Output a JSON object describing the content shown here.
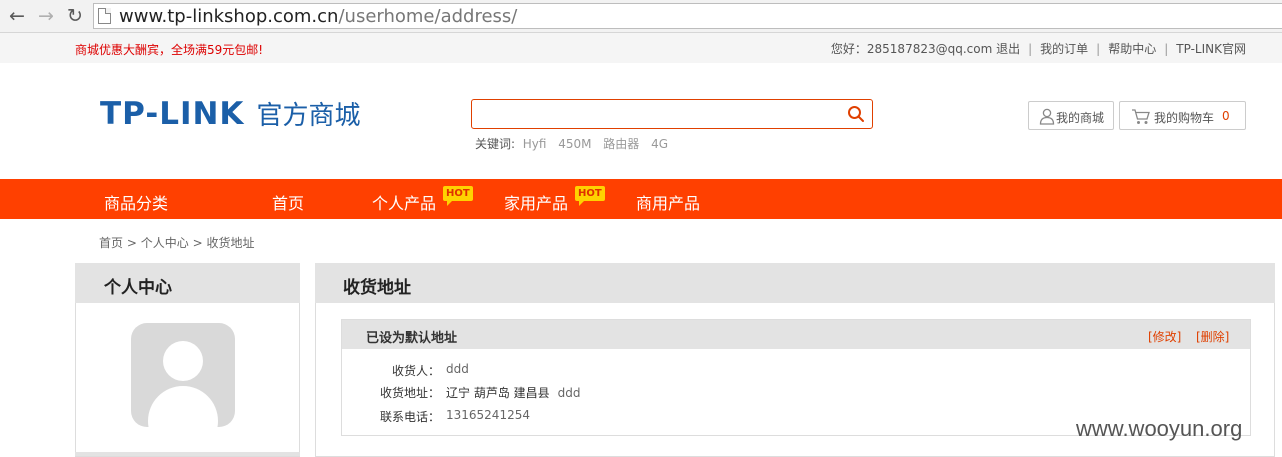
{
  "browser": {
    "url_host": "www.tp-linkshop.com.cn",
    "url_path": "/userhome/address/"
  },
  "top_bar": {
    "promo": "商城优惠大酬宾，全场满59元包邮!",
    "greeting": "您好：285187823@qq.com 退出",
    "my_orders": "我的订单",
    "help_center": "帮助中心",
    "official_site": "TP-LINK官网"
  },
  "header": {
    "logo_brand": "TP-LINK",
    "logo_sub": "官方商城",
    "search_placeholder": "",
    "keywords_label": "关键词:",
    "keywords": [
      "Hyfi",
      "450M",
      "路由器",
      "4G"
    ],
    "my_mall": "我的商城",
    "my_cart": "我的购物车",
    "cart_count": "0"
  },
  "nav": {
    "category": "商品分类",
    "home": "首页",
    "personal": "个人产品",
    "home_products": "家用产品",
    "business": "商用产品",
    "hot": "HOT"
  },
  "breadcrumb": {
    "home": "首页",
    "center": "个人中心",
    "current": "收货地址",
    "sep": ">"
  },
  "sidebar": {
    "title": "个人中心"
  },
  "panel": {
    "title": "收货地址",
    "card": {
      "status": "已设为默认地址",
      "edit": "[修改]",
      "delete": "[删除]",
      "recipient_label": "收货人：",
      "recipient": "ddd",
      "address_label": "收货地址：",
      "region": "辽宁 葫芦岛 建昌县",
      "address": "ddd",
      "phone_label": "联系电话：",
      "phone": "13165241254"
    }
  },
  "watermark": "www.wooyun.org",
  "colors": {
    "accent": "#ff4000",
    "brand": "#1b5fa8"
  }
}
